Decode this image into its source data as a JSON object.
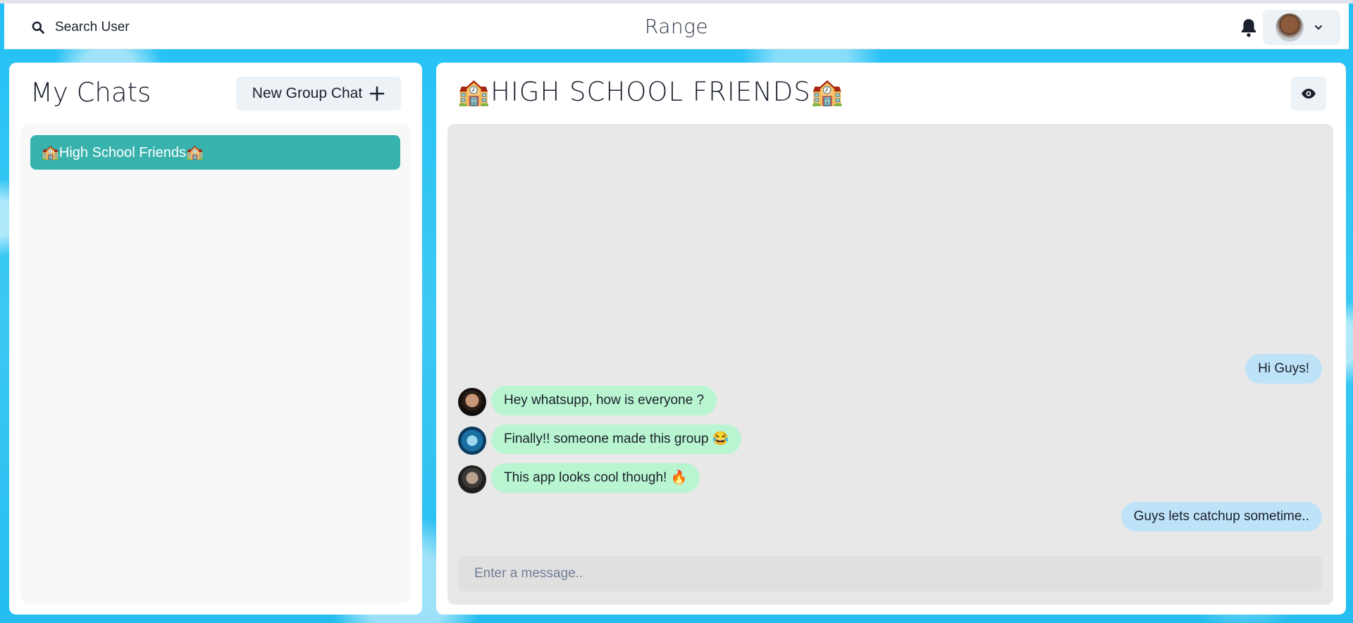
{
  "header": {
    "search_label": "Search User",
    "app_title": "Range"
  },
  "sidebar": {
    "title": "My Chats",
    "new_group_label": "New Group Chat",
    "chats": [
      {
        "name": "🏫High School Friends🏫",
        "selected": true
      }
    ]
  },
  "chat": {
    "title": "🏫HIGH SCHOOL FRIENDS🏫",
    "messages": [
      {
        "text": "Hi Guys!",
        "mine": true
      },
      {
        "text": "Hey whatsupp, how is everyone ?",
        "mine": false
      },
      {
        "text": "Finally!! someone made this group 😂",
        "mine": false
      },
      {
        "text": "This app looks cool though! 🔥",
        "mine": false
      },
      {
        "text": "Guys lets catchup sometime..",
        "mine": true
      }
    ],
    "input_placeholder": "Enter a message.."
  },
  "colors": {
    "selected_chat": "#38b2ac",
    "my_bubble": "#bee3f8",
    "their_bubble": "#b9f5d0",
    "background": "#2ec4f1"
  }
}
